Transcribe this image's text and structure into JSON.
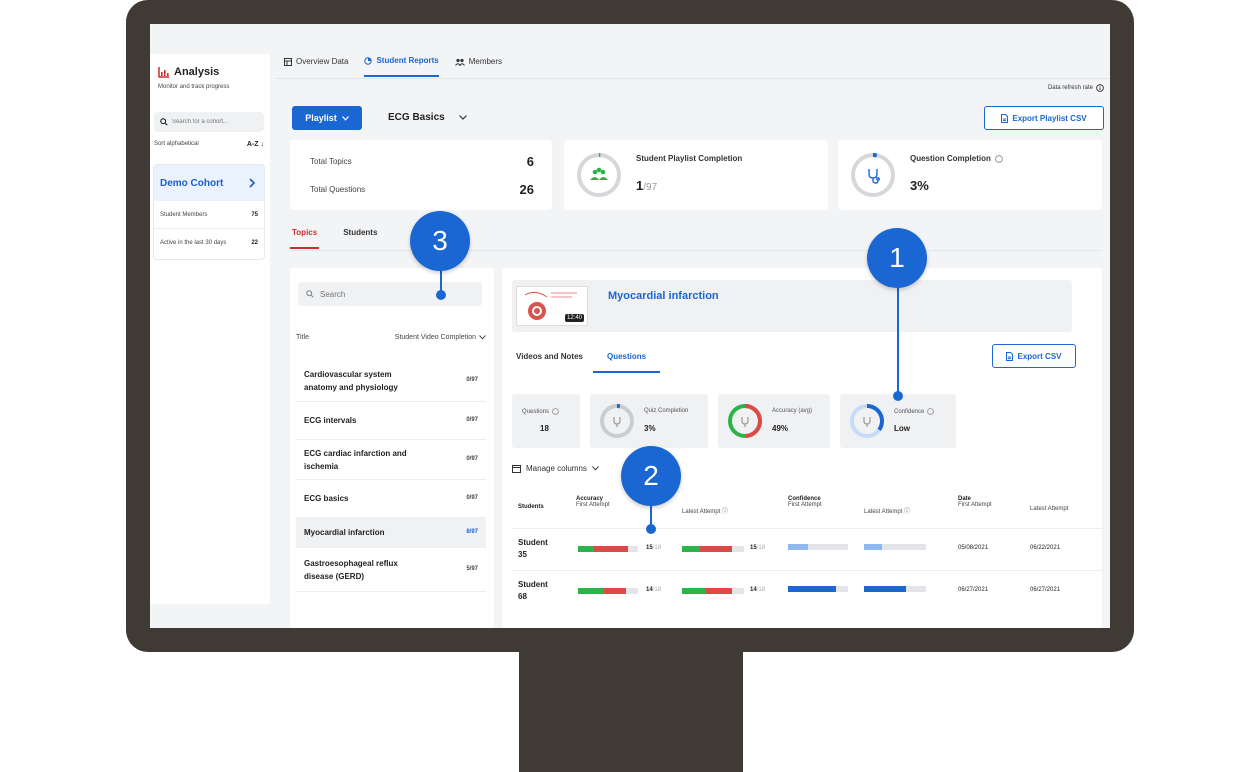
{
  "sidebar": {
    "title": "Analysis",
    "subtitle": "Monitor and track progress",
    "search_placeholder": "Search for a cohort...",
    "sort_label": "Sort alphabetical",
    "sort_value": "A-Z",
    "cohort": {
      "name": "Demo Cohort",
      "stats": [
        {
          "label": "Student Members",
          "value": "75"
        },
        {
          "label": "Active in the last 30 days",
          "value": "22"
        }
      ]
    }
  },
  "topnav": {
    "tabs": [
      {
        "label": "Overview Data",
        "icon": "table-icon"
      },
      {
        "label": "Student Reports",
        "icon": "chart-icon"
      },
      {
        "label": "Members",
        "icon": "users-icon"
      }
    ],
    "refresh_label": "Data refresh rate"
  },
  "toolbar": {
    "playlist_label": "Playlist",
    "playlist_value": "ECG Basics",
    "export_playlist_label": "Export Playlist CSV"
  },
  "summary": {
    "total_topics_label": "Total Topics",
    "total_topics_value": "6",
    "total_questions_label": "Total Questions",
    "total_questions_value": "26",
    "playlist_completion_label": "Student Playlist Completion",
    "playlist_completion_value": "1",
    "playlist_completion_total": "/97",
    "question_completion_label": "Question Completion",
    "question_completion_value": "3%"
  },
  "subtabs": [
    "Topics",
    "Students"
  ],
  "topics": {
    "search_placeholder": "Search",
    "col_title": "Title",
    "col_completion": "Student Video Completion",
    "items": [
      {
        "title": "Cardiovascular system anatomy and physiology",
        "count": "0/97"
      },
      {
        "title": "ECG intervals",
        "count": "0/97"
      },
      {
        "title": "ECG cardiac infarction and ischemia",
        "count": "0/97"
      },
      {
        "title": "ECG basics",
        "count": "0/97"
      },
      {
        "title": "Myocardial infarction",
        "count": "8/97"
      },
      {
        "title": "Gastroesophageal reflux disease (GERD)",
        "count": "5/97"
      }
    ]
  },
  "detail": {
    "video_title": "Myocardial infarction",
    "video_duration": "12:40",
    "tabs": [
      "Videos and Notes",
      "Questions"
    ],
    "export_csv_label": "Export CSV",
    "metrics": [
      {
        "label": "Questions",
        "value": "18"
      },
      {
        "label": "Quiz Completion",
        "value": "3%",
        "fraction": 0.03
      },
      {
        "label": "Accuracy (avg)",
        "value": "49%",
        "fraction": 0.49
      },
      {
        "label": "Confidence",
        "value": "Low",
        "fraction": 0.35
      }
    ],
    "manage_columns_label": "Manage columns",
    "table": {
      "col_students": "Students",
      "col_accuracy": "Accuracy",
      "col_first_attempt": "First Attempt",
      "col_latest_attempt": "Latest Attempt",
      "col_confidence": "Confidence",
      "col_conf_first": "First Attempt",
      "col_conf_latest": "Latest Attempt",
      "col_date": "Date",
      "col_date_first": "First Attempt",
      "col_date_latest": "Latest Attempt",
      "rows": [
        {
          "name": "Student 35",
          "first_score": "15",
          "first_total": "/18",
          "latest_score": "15",
          "latest_total": "/18",
          "first_date": "05/08/2021",
          "latest_date": "06/22/2021"
        },
        {
          "name": "Student 68",
          "first_score": "14",
          "first_total": "/18",
          "latest_score": "14",
          "latest_total": "/18",
          "first_date": "06/27/2021",
          "latest_date": "06/27/2021"
        }
      ]
    }
  },
  "callouts": [
    "1",
    "2",
    "3"
  ],
  "colors": {
    "accent": "#1a66d2",
    "active_tab_red": "#c9302c",
    "correct": "#2db34a",
    "incorrect": "#e04848",
    "monitor": "#3f3a33"
  }
}
